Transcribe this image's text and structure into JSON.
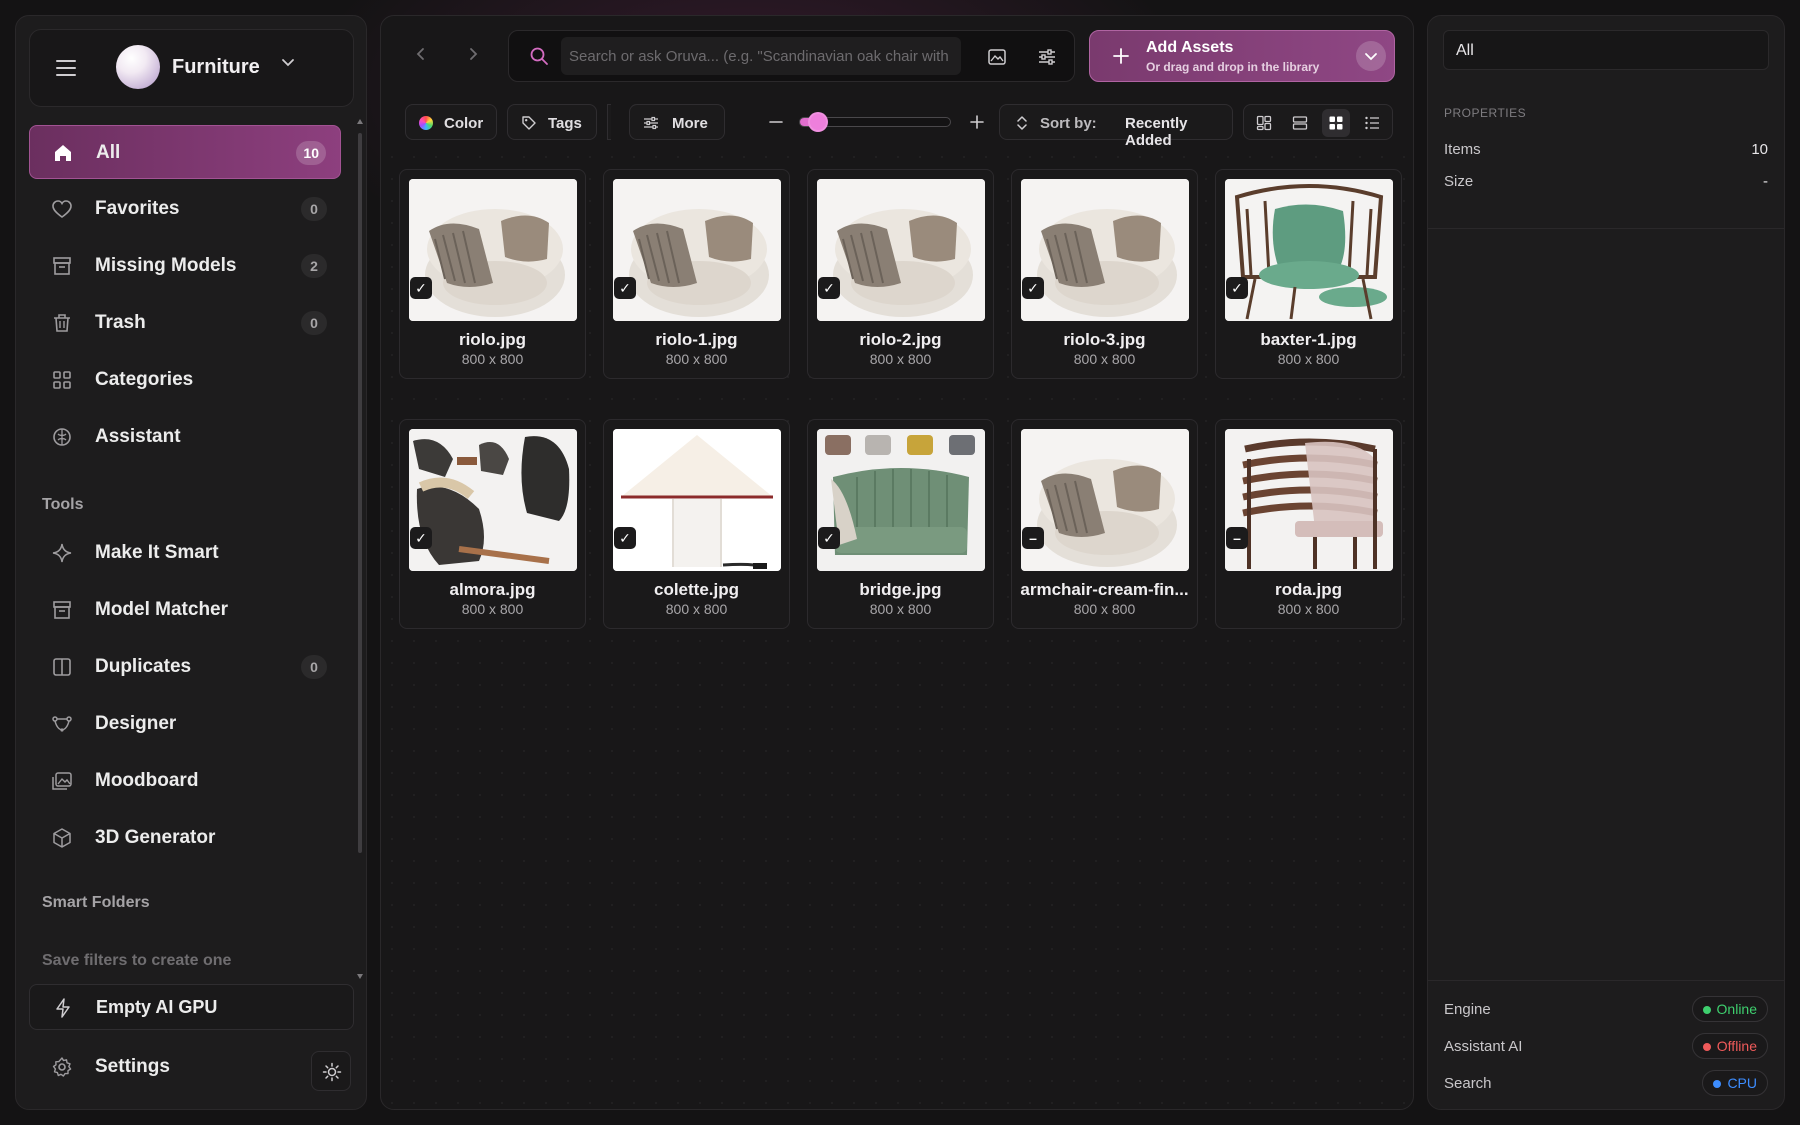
{
  "sidebar": {
    "library_name": "Furniture",
    "nav": [
      {
        "label": "All",
        "count": "10",
        "icon": "home-icon",
        "active": true
      },
      {
        "label": "Favorites",
        "count": "0",
        "icon": "heart-icon"
      },
      {
        "label": "Missing Models",
        "count": "2",
        "icon": "archive-icon"
      },
      {
        "label": "Trash",
        "count": "0",
        "icon": "trash-icon"
      },
      {
        "label": "Categories",
        "icon": "grid-icon"
      },
      {
        "label": "Assistant",
        "icon": "brain-icon"
      }
    ],
    "tools_heading": "Tools",
    "tools": [
      {
        "label": "Make It Smart",
        "icon": "sparkle-icon"
      },
      {
        "label": "Model Matcher",
        "icon": "archive-icon"
      },
      {
        "label": "Duplicates",
        "count": "0",
        "icon": "duplicate-icon"
      },
      {
        "label": "Designer",
        "icon": "bezier-icon"
      },
      {
        "label": "Moodboard",
        "icon": "image-stack-icon"
      },
      {
        "label": "3D Generator",
        "icon": "cube-icon"
      }
    ],
    "smart_folders_heading": "Smart Folders",
    "smart_folders_hint": "Save filters to create one",
    "gpu_button": "Empty AI GPU",
    "settings_label": "Settings"
  },
  "search": {
    "placeholder": "Search or ask Oruva... (e.g. \"Scandinavian oak chair with"
  },
  "add_assets": {
    "title": "Add Assets",
    "subtitle": "Or drag and drop in the library"
  },
  "filters": {
    "color": "Color",
    "tags": "Tags",
    "more": "More",
    "zoom_level": 0.12,
    "sort_key": "Sort by:",
    "sort_value": "Recently Added",
    "view_modes": [
      "masonry",
      "rows",
      "grid",
      "list"
    ],
    "active_view": "grid"
  },
  "assets": [
    {
      "name": "riolo.jpg",
      "dims": "800 x 800",
      "kind": "cream-armchair",
      "checked": true
    },
    {
      "name": "riolo-1.jpg",
      "dims": "800 x 800",
      "kind": "cream-armchair",
      "checked": true
    },
    {
      "name": "riolo-2.jpg",
      "dims": "800 x 800",
      "kind": "cream-armchair",
      "checked": true
    },
    {
      "name": "riolo-3.jpg",
      "dims": "800 x 800",
      "kind": "cream-armchair",
      "checked": true
    },
    {
      "name": "baxter-1.jpg",
      "dims": "800 x 800",
      "kind": "green-leather-chair",
      "checked": true
    },
    {
      "name": "almora.jpg",
      "dims": "800 x 800",
      "kind": "lounge-chairs",
      "checked": true
    },
    {
      "name": "colette.jpg",
      "dims": "800 x 800",
      "kind": "table-lamp",
      "checked": true
    },
    {
      "name": "bridge.jpg",
      "dims": "800 x 800",
      "kind": "green-velvet-armchair",
      "checked": true
    },
    {
      "name": "armchair-cream-fin...",
      "dims": "800 x 800",
      "kind": "cream-armchair",
      "checked": false
    },
    {
      "name": "roda.jpg",
      "dims": "800 x 800",
      "kind": "wood-slat-chair",
      "checked": false
    }
  ],
  "right_panel": {
    "filter_value": "All",
    "properties_heading": "PROPERTIES",
    "properties": [
      {
        "key": "Items",
        "value": "10"
      },
      {
        "key": "Size",
        "value": "-"
      }
    ],
    "status": [
      {
        "key": "Engine",
        "value": "Online",
        "color": "#3ecf6e"
      },
      {
        "key": "Assistant AI",
        "value": "Offline",
        "color": "#ef5a5a"
      },
      {
        "key": "Search",
        "value": "CPU",
        "color": "#3d8dff"
      }
    ]
  },
  "colors": {
    "accent": "#8d3f7e",
    "accent_bright": "#e26fcf",
    "background": "#141314"
  }
}
